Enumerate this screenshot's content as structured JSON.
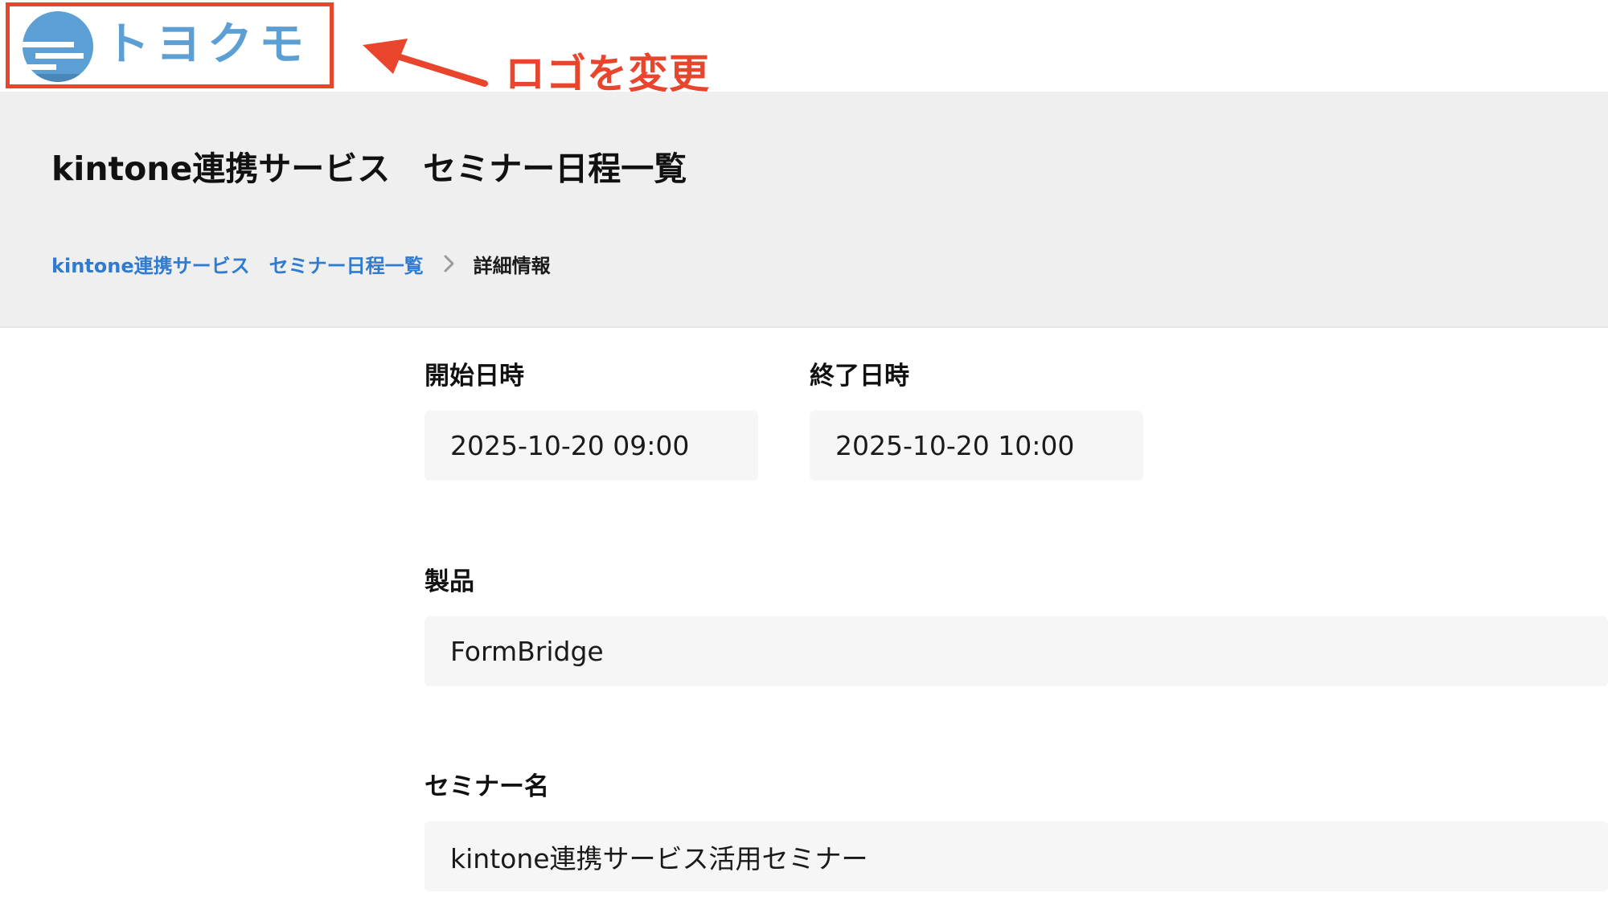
{
  "logo": {
    "text": "トヨクモ",
    "color": "#5b9fd4"
  },
  "annotation": {
    "text": "ロゴを変更",
    "color": "#e8452c"
  },
  "header": {
    "title": "kintone連携サービス　セミナー日程一覧"
  },
  "breadcrumb": {
    "link": "kintone連携サービス　セミナー日程一覧",
    "current": "詳細情報",
    "link_color": "#2f7bd0"
  },
  "fields": {
    "start": {
      "label": "開始日時",
      "value": "2025-10-20 09:00"
    },
    "end": {
      "label": "終了日時",
      "value": "2025-10-20 10:00"
    },
    "product": {
      "label": "製品",
      "value": "FormBridge"
    },
    "seminar_name": {
      "label": "セミナー名",
      "value": "kintone連携サービス活用セミナー"
    }
  }
}
